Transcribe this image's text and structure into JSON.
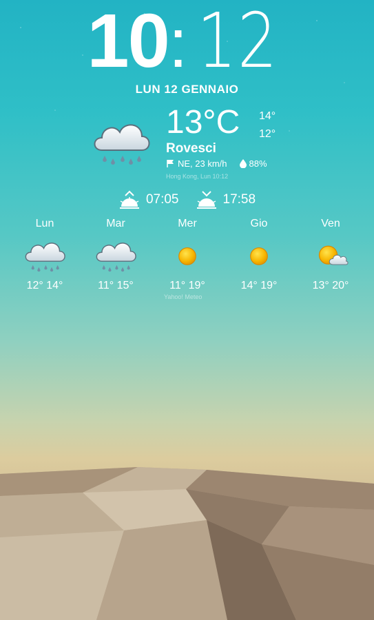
{
  "clock": {
    "hours": "10",
    "separator": ":",
    "minutes": "12"
  },
  "date": "LUN 12 GENNAIO",
  "current": {
    "temperature": "13°C",
    "high": "14°",
    "low": "12°",
    "condition": "Rovesci",
    "wind": "NE, 23 km/h",
    "humidity": "88%",
    "location": "Hong Kong, Lun 10:12",
    "icon": "rain-cloud-icon"
  },
  "sun": {
    "sunrise": "07:05",
    "sunset": "17:58"
  },
  "forecast": [
    {
      "day": "Lun",
      "temps": "12° 14°",
      "icon": "rain-cloud-icon"
    },
    {
      "day": "Mar",
      "temps": "11° 15°",
      "icon": "rain-cloud-icon"
    },
    {
      "day": "Mer",
      "temps": "11° 19°",
      "icon": "sun-icon"
    },
    {
      "day": "Gio",
      "temps": "14° 19°",
      "icon": "sun-icon"
    },
    {
      "day": "Ven",
      "temps": "13° 20°",
      "icon": "partly-cloudy-icon"
    }
  ],
  "provider": "Yahoo! Meteo",
  "colors": {
    "text": "#ffffff",
    "sun": "#f5b800",
    "sky_top": "#22b3c4",
    "sand": "#b9a58c"
  }
}
